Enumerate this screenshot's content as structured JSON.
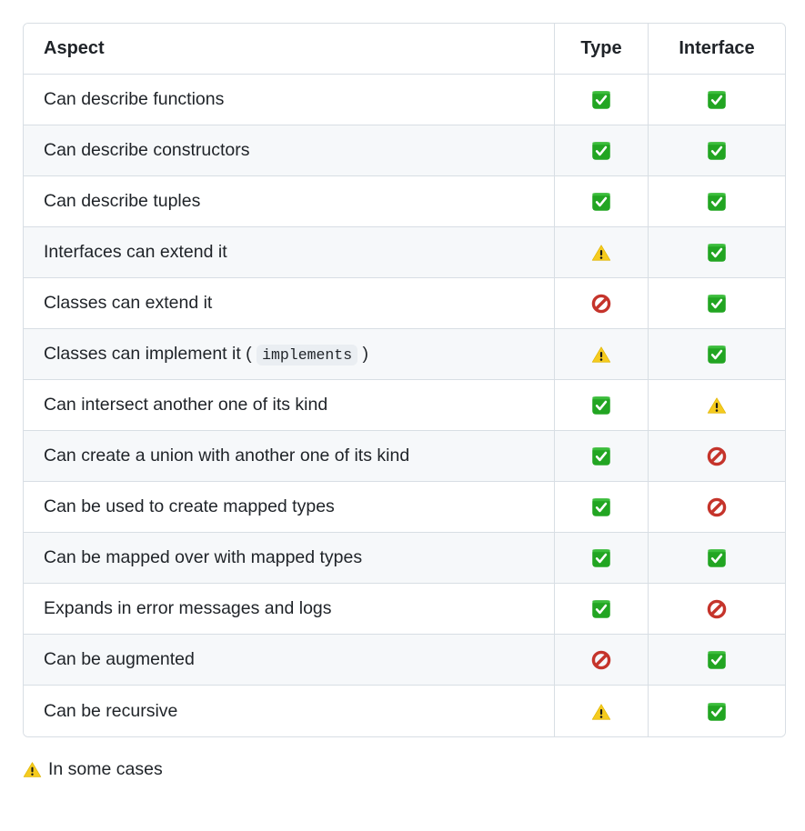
{
  "table": {
    "columns": [
      {
        "key": "aspect",
        "label": "Aspect",
        "align": "left"
      },
      {
        "key": "type",
        "label": "Type",
        "align": "center"
      },
      {
        "key": "interface",
        "label": "Interface",
        "align": "center"
      }
    ],
    "rows": [
      {
        "aspect": "Can describe functions",
        "aspect_code": "",
        "aspect_suffix": "",
        "type": "check",
        "interface": "check"
      },
      {
        "aspect": "Can describe constructors",
        "aspect_code": "",
        "aspect_suffix": "",
        "type": "check",
        "interface": "check"
      },
      {
        "aspect": "Can describe tuples",
        "aspect_code": "",
        "aspect_suffix": "",
        "type": "check",
        "interface": "check"
      },
      {
        "aspect": "Interfaces can extend it",
        "aspect_code": "",
        "aspect_suffix": "",
        "type": "warning",
        "interface": "check"
      },
      {
        "aspect": "Classes can extend it",
        "aspect_code": "",
        "aspect_suffix": "",
        "type": "prohibited",
        "interface": "check"
      },
      {
        "aspect": "Classes can implement it (",
        "aspect_code": "implements",
        "aspect_suffix": ")",
        "type": "warning",
        "interface": "check"
      },
      {
        "aspect": "Can intersect another one of its kind",
        "aspect_code": "",
        "aspect_suffix": "",
        "type": "check",
        "interface": "warning"
      },
      {
        "aspect": "Can create a union with another one of its kind",
        "aspect_code": "",
        "aspect_suffix": "",
        "type": "check",
        "interface": "prohibited"
      },
      {
        "aspect": "Can be used to create mapped types",
        "aspect_code": "",
        "aspect_suffix": "",
        "type": "check",
        "interface": "prohibited"
      },
      {
        "aspect": "Can be mapped over with mapped types",
        "aspect_code": "",
        "aspect_suffix": "",
        "type": "check",
        "interface": "check"
      },
      {
        "aspect": "Expands in error messages and logs",
        "aspect_code": "",
        "aspect_suffix": "",
        "type": "check",
        "interface": "prohibited"
      },
      {
        "aspect": "Can be augmented",
        "aspect_code": "",
        "aspect_suffix": "",
        "type": "prohibited",
        "interface": "check"
      },
      {
        "aspect": "Can be recursive",
        "aspect_code": "",
        "aspect_suffix": "",
        "type": "warning",
        "interface": "check"
      }
    ]
  },
  "icons": {
    "check": {
      "name": "check-mark-button-icon",
      "char": "✅"
    },
    "warning": {
      "name": "warning-sign-icon",
      "char": "⚠️"
    },
    "prohibited": {
      "name": "prohibited-sign-icon",
      "char": "🚫"
    }
  },
  "footnote": {
    "icon": "warning",
    "text": "In some cases"
  },
  "colors": {
    "check_green": "#22a522",
    "warning_yellow": "#f5cb1f",
    "prohibited_red": "#c5342b",
    "border": "#d8dee4",
    "row_alt_bg": "#f6f8fa",
    "text": "#1f2328",
    "code_bg": "#eaeef2"
  }
}
